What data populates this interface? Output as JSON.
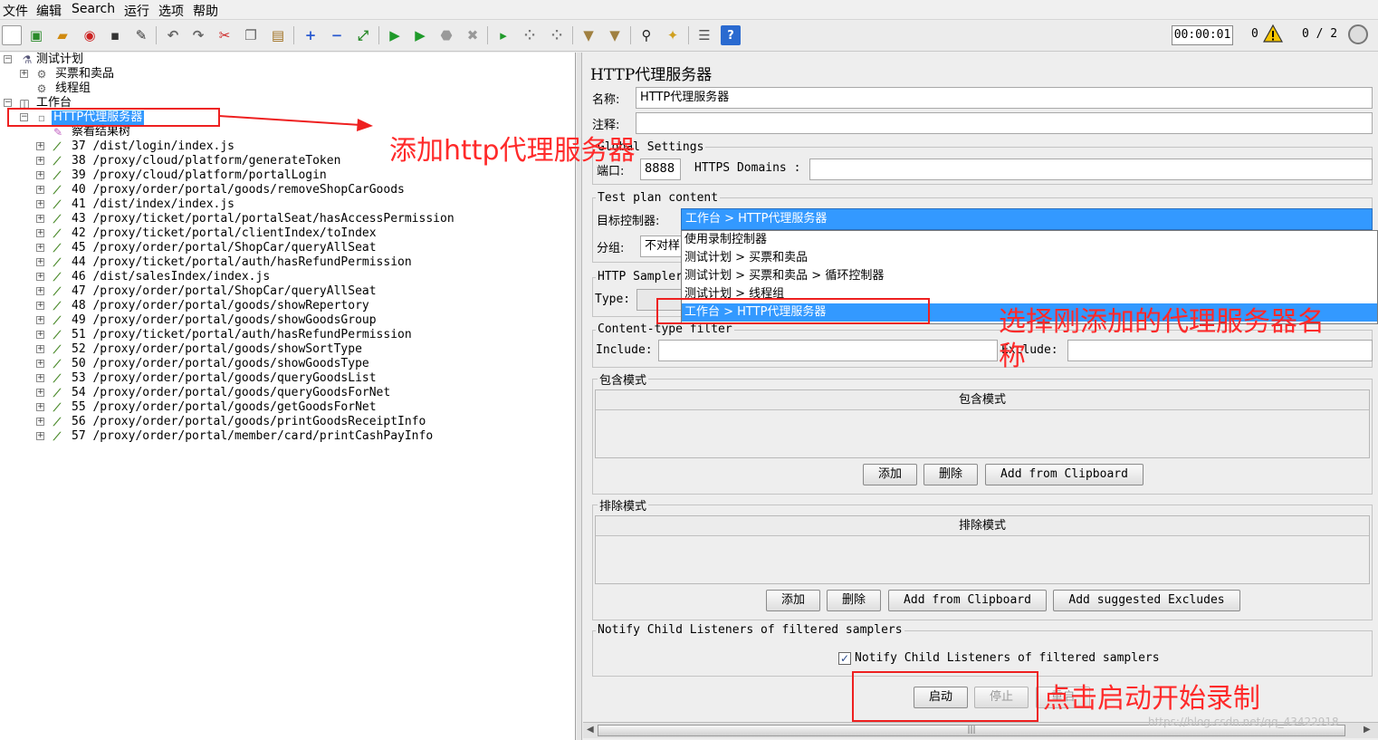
{
  "menu": [
    "文件",
    "编辑",
    "Search",
    "运行",
    "选项",
    "帮助"
  ],
  "toolbar": {
    "timer": "00:00:01",
    "error_count": "0",
    "thread_count": "0 / 2",
    "icons": [
      "new-icon",
      "templates-icon",
      "open-icon",
      "close-icon",
      "save-icon",
      "save-as-icon",
      "undo-icon",
      "redo-icon",
      "cut-icon",
      "copy-icon",
      "paste-icon",
      "expand-icon",
      "collapse-icon",
      "toggle-icon",
      "start-icon",
      "start-no-pause-icon",
      "stop-icon",
      "shutdown-icon",
      "remote-start-icon",
      "remote-stop-icon",
      "remote-shutdown-icon",
      "clear-icon",
      "clear-all-icon",
      "search-icon",
      "reset-search-icon",
      "function-helper-icon",
      "help-icon"
    ]
  },
  "tree": {
    "root": "测试计划",
    "plan_children": [
      "买票和卖品",
      "线程组"
    ],
    "workbench": "工作台",
    "proxy": "HTTP代理服务器",
    "listener": "察看结果树",
    "samplers": [
      "37 /dist/login/index.js",
      "38 /proxy/cloud/platform/generateToken",
      "39 /proxy/cloud/platform/portalLogin",
      "40 /proxy/order/portal/goods/removeShopCarGoods",
      "41 /dist/index/index.js",
      "43 /proxy/ticket/portal/portalSeat/hasAccessPermission",
      "42 /proxy/ticket/portal/clientIndex/toIndex",
      "45 /proxy/order/portal/ShopCar/queryAllSeat",
      "44 /proxy/ticket/portal/auth/hasRefundPermission",
      "46 /dist/salesIndex/index.js",
      "47 /proxy/order/portal/ShopCar/queryAllSeat",
      "48 /proxy/order/portal/goods/showRepertory",
      "49 /proxy/order/portal/goods/showGoodsGroup",
      "51 /proxy/ticket/portal/auth/hasRefundPermission",
      "52 /proxy/order/portal/goods/showSortType",
      "50 /proxy/order/portal/goods/showGoodsType",
      "53 /proxy/order/portal/goods/queryGoodsList",
      "54 /proxy/order/portal/goods/queryGoodsForNet",
      "55 /proxy/order/portal/goods/getGoodsForNet",
      "56 /proxy/order/portal/goods/printGoodsReceiptInfo",
      "57 /proxy/order/portal/member/card/printCashPayInfo"
    ]
  },
  "panel": {
    "title": "HTTP代理服务器",
    "name_label": "名称:",
    "name_value": "HTTP代理服务器",
    "comment_label": "注释:",
    "global_settings": "Global Settings",
    "port_label": "端口:",
    "port_value": "8888",
    "https_label": "HTTPS Domains :",
    "test_plan_content": "Test plan content",
    "target_label": "目标控制器:",
    "target_value": "工作台 > HTTP代理服务器",
    "group_label": "分组:",
    "group_value": "不对样",
    "http_sampler": "HTTP Sampler",
    "type_label": "Type:",
    "content_filter": "Content-type filter",
    "include_label": "Include:",
    "exclude_label": "Exclude:",
    "include_patterns": {
      "section": "包含模式",
      "column": "包含模式",
      "add": "添加",
      "delete": "删除",
      "clipboard": "Add from Clipboard"
    },
    "exclude_patterns": {
      "section": "排除模式",
      "column": "排除模式",
      "add": "添加",
      "delete": "删除",
      "clipboard": "Add from Clipboard",
      "suggested": "Add suggested Excludes"
    },
    "notify_section": "Notify Child Listeners of filtered samplers",
    "notify_checkbox": "Notify Child Listeners of filtered samplers",
    "notify_checked": true,
    "start": "启动",
    "stop": "停止",
    "restart": "重启",
    "scroll_grip": "|||"
  },
  "dropdown_options": [
    "使用录制控制器",
    "测试计划 > 买票和卖品",
    "测试计划 > 买票和卖品 > 循环控制器",
    "测试计划 > 线程组",
    "工作台 > HTTP代理服务器"
  ],
  "annotations": {
    "add_proxy": "添加http代理服务器",
    "select_line1": "选择刚添加的代理服务器名",
    "select_line2": "称",
    "click_start": "点击启动开始录制"
  },
  "watermark": "https://blog.csdn.net/qq_43422918",
  "colors": {
    "selection": "#3399ff",
    "annotation": "#ff2a2a"
  }
}
